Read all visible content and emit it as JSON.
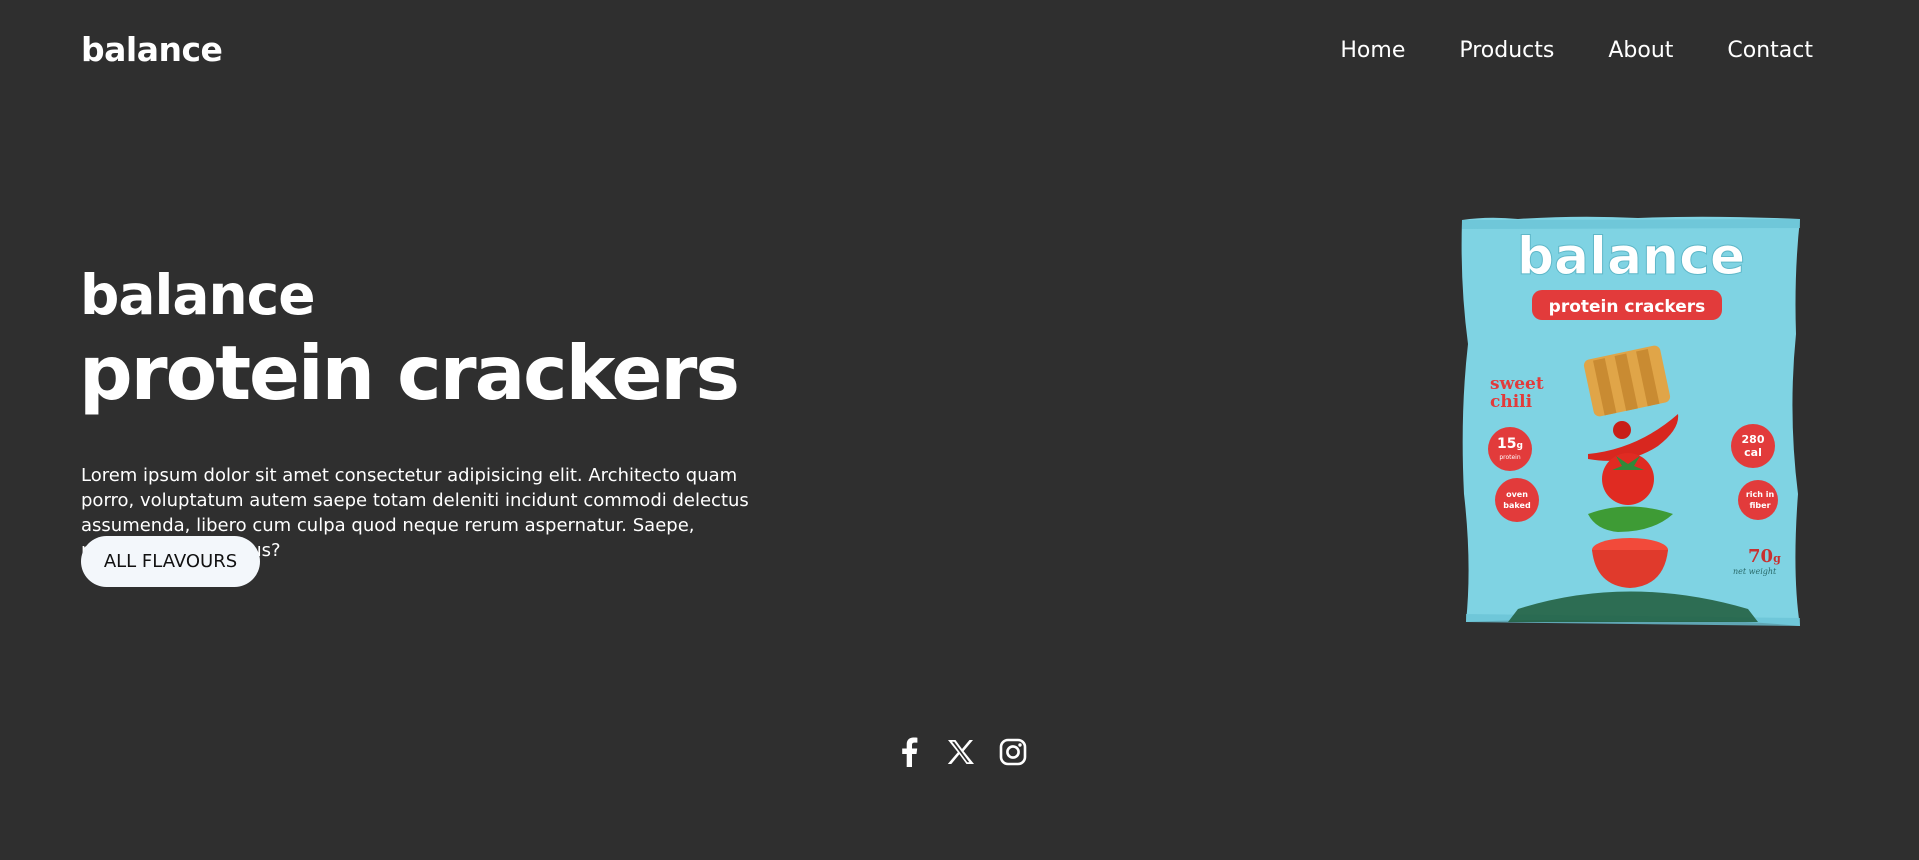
{
  "header": {
    "logo": "balance",
    "nav": [
      "Home",
      "Products",
      "About",
      "Contact"
    ]
  },
  "hero": {
    "subtitle": "balance",
    "title": "protein crackers",
    "description": "Lorem ipsum dolor sit amet consectetur adipisicing elit. Architecto quam porro, voluptatum autem saepe totam deleniti incidunt commodi delectus assumenda, libero cum culpa quod neque rerum aspernatur. Saepe, necessitatibus minus?",
    "cta_label": "ALL FLAVOURS"
  },
  "product": {
    "brand": "balance",
    "label": "protein crackers",
    "flavor": "sweet chili",
    "badges": [
      "15g protein",
      "280 cal",
      "oven baked",
      "rich in fiber"
    ],
    "weight": "70g net weight"
  },
  "social": [
    "facebook-icon",
    "x-icon",
    "instagram-icon"
  ],
  "colors": {
    "background": "#2f2f2f",
    "text": "#ffffff",
    "button_bg": "#f3f7fb",
    "bag": "#7fd3e3",
    "bag_red": "#e23b3b"
  }
}
